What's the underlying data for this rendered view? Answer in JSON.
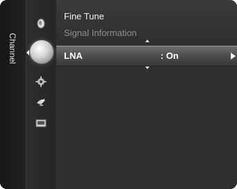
{
  "sidebar": {
    "tab_label": "Channel"
  },
  "icons": [
    {
      "name": "antenna-icon"
    },
    {
      "name": "channel-icon",
      "selected": true
    },
    {
      "name": "gear-icon"
    },
    {
      "name": "satellite-dish-icon"
    },
    {
      "name": "input-icon"
    }
  ],
  "menu": {
    "items": [
      {
        "label": "Fine Tune",
        "state": "normal"
      },
      {
        "label": "Signal Information",
        "state": "disabled"
      }
    ],
    "selected": {
      "label": "LNA",
      "value": ": On"
    }
  },
  "colors": {
    "highlight": "#5a5a5a",
    "disabled_text": "#8e8e8e",
    "panel": "#303030"
  }
}
